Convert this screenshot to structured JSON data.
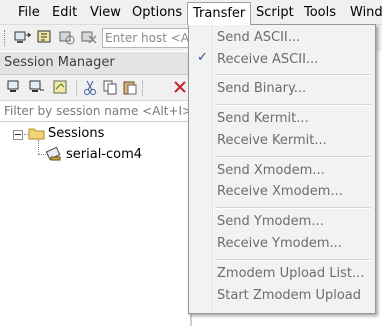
{
  "menubar": {
    "items": [
      {
        "label": "File"
      },
      {
        "label": "Edit"
      },
      {
        "label": "View"
      },
      {
        "label": "Options"
      },
      {
        "label": "Transfer"
      },
      {
        "label": "Script"
      },
      {
        "label": "Tools"
      },
      {
        "label": "Wind"
      }
    ]
  },
  "toolbar": {
    "host_placeholder": "Enter host <Alt"
  },
  "session_manager": {
    "title": "Session Manager",
    "filter_placeholder": "Filter by session name <Alt+I>",
    "tree": {
      "root": "Sessions",
      "children": [
        "serial-com4"
      ]
    }
  },
  "transfer_menu": {
    "items": [
      {
        "label": "Send ASCII..."
      },
      {
        "label": "Receive ASCII...",
        "checked": true
      },
      {
        "label": "Send Binary..."
      },
      {
        "label": "Send Kermit..."
      },
      {
        "label": "Receive Kermit..."
      },
      {
        "label": "Send Xmodem..."
      },
      {
        "label": "Receive Xmodem..."
      },
      {
        "label": "Send Ymodem..."
      },
      {
        "label": "Receive Ymodem..."
      },
      {
        "label": "Zmodem Upload List..."
      },
      {
        "label": "Start Zmodem Upload"
      }
    ]
  }
}
